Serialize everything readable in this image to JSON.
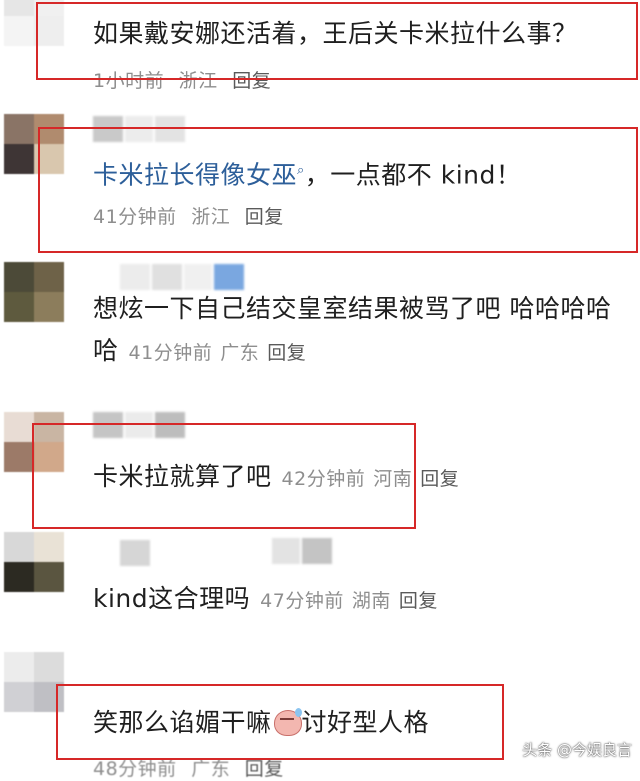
{
  "comments": [
    {
      "text": "如果戴安娜还活着，王后关卡米拉什么事？",
      "time": "1小时前",
      "location": "浙江",
      "reply": "回复"
    },
    {
      "text": "卡米拉长得像女巫",
      "search_icon": "search-icon",
      "text_suffix": "，一点都不 kind！",
      "time": "41分钟前",
      "location": "浙江",
      "reply": "回复"
    },
    {
      "text": "想炫一下自己结交皇室结果被骂了吧 哈哈哈哈哈",
      "time": "41分钟前",
      "location": "广东",
      "reply": "回复"
    },
    {
      "text": "卡米拉就算了吧",
      "time": "42分钟前",
      "location": "河南",
      "reply": "回复"
    },
    {
      "text": "kind这合理吗",
      "time": "47分钟前",
      "location": "湖南",
      "reply": "回复"
    },
    {
      "text_before": "笑那么谄媚干嘛",
      "emoji": "sweat-smile-emoji",
      "text_after": "讨好型人格",
      "time": "48分钟前",
      "location": "广东",
      "reply": "回复"
    }
  ],
  "watermark": "头条 @今娱良言",
  "colors": {
    "highlight_box": "#d62828",
    "link_text": "#2d5f9a",
    "meta_text": "#8e8e8e"
  }
}
